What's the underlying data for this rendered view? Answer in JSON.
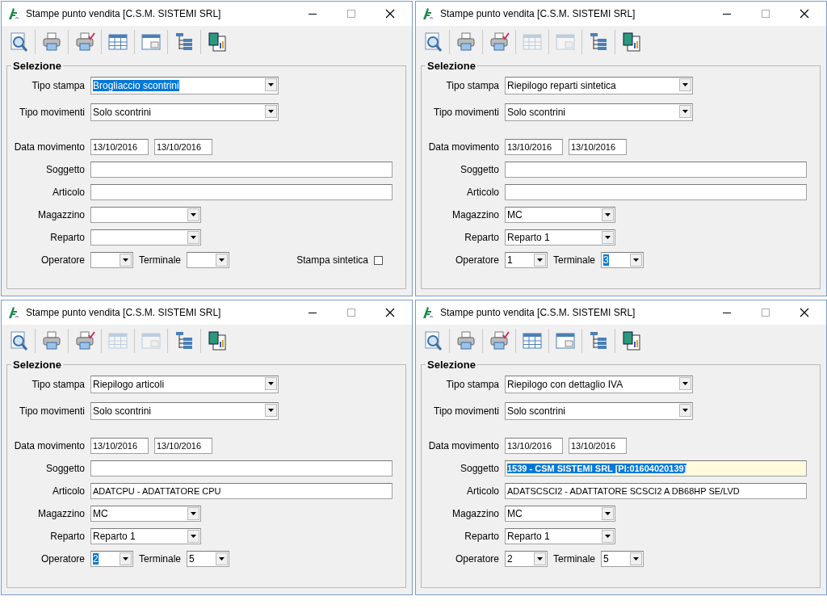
{
  "windows": [
    {
      "title": "Stampe punto vendita [C.S.M. SISTEMI SRL]",
      "toolbar": [
        {
          "kind": "preview",
          "disabled": false
        },
        {
          "kind": "print",
          "disabled": false
        },
        {
          "kind": "print-check",
          "disabled": false
        },
        {
          "kind": "grid",
          "disabled": false
        },
        {
          "kind": "form",
          "disabled": false
        },
        {
          "kind": "tree",
          "disabled": false
        },
        {
          "kind": "report",
          "disabled": false
        }
      ],
      "selection": {
        "title": "Selezione",
        "rows": [
          {
            "kind": "wide-combo",
            "label": "Tipo stampa",
            "value": "Brogliaccio scontrini",
            "highlighted": true
          },
          {
            "kind": "wide-combo",
            "label": "Tipo movimenti",
            "value": "Solo scontrini",
            "highlighted": false
          },
          {
            "kind": "dates",
            "label": "Data movimento",
            "values": [
              "13/10/2016",
              "13/10/2016"
            ]
          },
          {
            "kind": "text",
            "label": "Soggetto",
            "highlighted": false
          },
          {
            "kind": "text",
            "label": "Articolo",
            "highlighted": false
          },
          {
            "kind": "combo",
            "label": "Magazzino"
          },
          {
            "kind": "combo",
            "label": "Reparto"
          },
          {
            "kind": "pair",
            "fields": [
              {
                "label": "Operatore"
              },
              {
                "label": "Terminale"
              }
            ],
            "option": {
              "label": "Stampa sintetica",
              "checked": false
            }
          }
        ]
      }
    },
    {
      "title": "Stampe punto vendita [C.S.M. SISTEMI SRL]",
      "toolbar": [
        {
          "kind": "preview",
          "disabled": false
        },
        {
          "kind": "print",
          "disabled": false
        },
        {
          "kind": "print-check",
          "disabled": false
        },
        {
          "kind": "grid",
          "disabled": true
        },
        {
          "kind": "form",
          "disabled": true
        },
        {
          "kind": "tree",
          "disabled": false
        },
        {
          "kind": "report",
          "disabled": false
        }
      ],
      "selection": {
        "title": "Selezione",
        "rows": [
          {
            "kind": "wide-combo",
            "label": "Tipo stampa",
            "value": "Riepilogo reparti sintetica",
            "highlighted": false
          },
          {
            "kind": "wide-combo",
            "label": "Tipo movimenti",
            "value": "Solo scontrini",
            "highlighted": false
          },
          {
            "kind": "dates",
            "label": "Data movimento",
            "values": [
              "13/10/2016",
              "13/10/2016"
            ]
          },
          {
            "kind": "text",
            "label": "Soggetto",
            "highlighted": false
          },
          {
            "kind": "text",
            "label": "Articolo",
            "highlighted": false
          },
          {
            "kind": "combo",
            "label": "Magazzino",
            "value": "MC",
            "highlighted": false
          },
          {
            "kind": "combo",
            "label": "Reparto",
            "value": "Reparto 1",
            "highlighted": false
          },
          {
            "kind": "pair",
            "fields": [
              {
                "label": "Operatore",
                "value": "1",
                "highlighted": false
              },
              {
                "label": "Terminale",
                "value": "3",
                "highlighted": true
              }
            ]
          }
        ]
      }
    },
    {
      "title": "Stampe punto vendita [C.S.M. SISTEMI SRL]",
      "toolbar": [
        {
          "kind": "preview",
          "disabled": false
        },
        {
          "kind": "print",
          "disabled": false
        },
        {
          "kind": "print-check",
          "disabled": false
        },
        {
          "kind": "grid",
          "disabled": true
        },
        {
          "kind": "form",
          "disabled": true
        },
        {
          "kind": "tree",
          "disabled": false
        },
        {
          "kind": "report",
          "disabled": false
        }
      ],
      "selection": {
        "title": "Selezione",
        "rows": [
          {
            "kind": "wide-combo",
            "label": "Tipo stampa",
            "value": "Riepilogo articoli",
            "highlighted": false
          },
          {
            "kind": "wide-combo",
            "label": "Tipo movimenti",
            "value": "Solo scontrini",
            "highlighted": false
          },
          {
            "kind": "dates",
            "label": "Data movimento",
            "values": [
              "13/10/2016",
              "13/10/2016"
            ]
          },
          {
            "kind": "text",
            "label": "Soggetto",
            "highlighted": false
          },
          {
            "kind": "text",
            "label": "Articolo",
            "value": "ADATCPU - ADATTATORE CPU",
            "highlighted": false
          },
          {
            "kind": "combo",
            "label": "Magazzino",
            "value": "MC",
            "highlighted": false
          },
          {
            "kind": "combo",
            "label": "Reparto",
            "value": "Reparto 1",
            "highlighted": false
          },
          {
            "kind": "pair",
            "fields": [
              {
                "label": "Operatore",
                "value": "2",
                "highlighted": true
              },
              {
                "label": "Terminale",
                "value": "5",
                "highlighted": false
              }
            ]
          }
        ]
      }
    },
    {
      "title": "Stampe punto vendita [C.S.M. SISTEMI SRL]",
      "toolbar": [
        {
          "kind": "preview",
          "disabled": false
        },
        {
          "kind": "print",
          "disabled": false
        },
        {
          "kind": "print-check",
          "disabled": false
        },
        {
          "kind": "grid",
          "disabled": false
        },
        {
          "kind": "form",
          "disabled": false
        },
        {
          "kind": "tree",
          "disabled": false
        },
        {
          "kind": "report",
          "disabled": false
        }
      ],
      "selection": {
        "title": "Selezione",
        "rows": [
          {
            "kind": "wide-combo",
            "label": "Tipo stampa",
            "value": "Riepilogo con dettaglio IVA",
            "highlighted": false
          },
          {
            "kind": "wide-combo",
            "label": "Tipo movimenti",
            "value": "Solo scontrini",
            "highlighted": false
          },
          {
            "kind": "dates",
            "label": "Data movimento",
            "values": [
              "13/10/2016",
              "13/10/2016"
            ]
          },
          {
            "kind": "text",
            "label": "Soggetto",
            "value": "1539 - CSM SISTEMI SRL [PI:01604020139]",
            "highlighted": true
          },
          {
            "kind": "text",
            "label": "Articolo",
            "value": "ADATSCSCI2 - ADATTATORE SCSCI2 A DB68HP SE/LVD",
            "highlighted": false
          },
          {
            "kind": "combo",
            "label": "Magazzino",
            "value": "MC",
            "highlighted": false
          },
          {
            "kind": "combo",
            "label": "Reparto",
            "value": "Reparto 1",
            "highlighted": false
          },
          {
            "kind": "pair",
            "fields": [
              {
                "label": "Operatore",
                "value": "2",
                "highlighted": false
              },
              {
                "label": "Terminale",
                "value": "5",
                "highlighted": false
              }
            ]
          }
        ]
      }
    }
  ]
}
